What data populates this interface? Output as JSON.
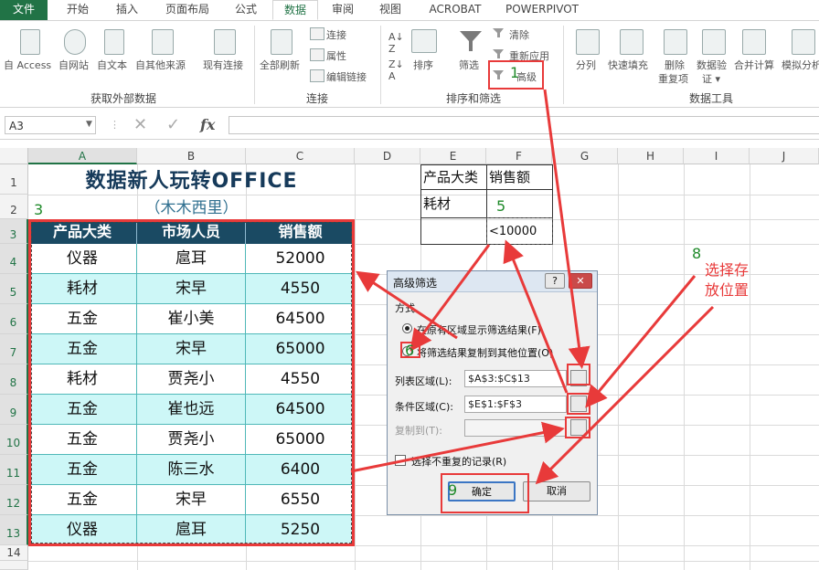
{
  "tabs": [
    "文件",
    "开始",
    "插入",
    "页面布局",
    "公式",
    "数据",
    "审阅",
    "视图",
    "ACROBAT",
    "POWERPIVOT"
  ],
  "ribbon": {
    "get_external": [
      "自 Access",
      "自网站",
      "自文本",
      "自其他来源",
      "现有连接"
    ],
    "get_external_group": "获取外部数据",
    "refresh_all": "全部刷新",
    "connections": "连接",
    "properties": "属性",
    "edit_links": "编辑链接",
    "connections_group": "连接",
    "sort": "排序",
    "filter": "筛选",
    "clear": "清除",
    "reapply": "重新应用",
    "advanced": "高级",
    "sort_filter_group": "排序和筛选",
    "text_to_columns": "分列",
    "flash_fill": "快速填充",
    "remove_dup_1": "删除",
    "remove_dup_2": "重复项",
    "validation_1": "数据验",
    "validation_2": "证 ▾",
    "consolidate": "合并计算",
    "what_if": "模拟分析",
    "data_tools_group": "数据工具"
  },
  "formula_bar": {
    "name_box": "A3",
    "cancel": "✕",
    "enter": "✓",
    "fx": "fx"
  },
  "columns": [
    "A",
    "B",
    "C",
    "D",
    "E",
    "F",
    "G",
    "H",
    "I",
    "J"
  ],
  "rows": [
    "1",
    "2",
    "3",
    "4",
    "5",
    "6",
    "7",
    "8",
    "9",
    "10",
    "11",
    "12",
    "13",
    "14"
  ],
  "sheet": {
    "title": "数据新人玩转OFFICE",
    "subtitle": "（木木西里）",
    "table_headers": [
      "产品大类",
      "市场人员",
      "销售额"
    ],
    "table_rows": [
      [
        "仪器",
        "扈耳",
        "52000"
      ],
      [
        "耗材",
        "宋早",
        "4550"
      ],
      [
        "五金",
        "崔小美",
        "64500"
      ],
      [
        "五金",
        "宋早",
        "65000"
      ],
      [
        "耗材",
        "贾尧小",
        "4550"
      ],
      [
        "五金",
        "崔也远",
        "64500"
      ],
      [
        "五金",
        "贾尧小",
        "65000"
      ],
      [
        "五金",
        "陈三水",
        "6400"
      ],
      [
        "五金",
        "宋早",
        "6550"
      ],
      [
        "仪器",
        "扈耳",
        "5250"
      ]
    ],
    "criteria_headers": [
      "产品大类",
      "销售额"
    ],
    "criteria_row1": [
      "耗材",
      ""
    ],
    "criteria_row2": [
      "",
      "<10000"
    ]
  },
  "dialog": {
    "title": "高级筛选",
    "help": "?",
    "close": "✕",
    "method_label": "方式",
    "option1": "在原有区域显示筛选结果(F)",
    "option2": "将筛选结果复制到其他位置(O)",
    "list_range_label": "列表区域(L):",
    "list_range_value": "$A$3:$C$13",
    "criteria_range_label": "条件区域(C):",
    "criteria_range_value": "$E$1:$F$3",
    "copy_to_label": "复制到(T):",
    "copy_to_value": "",
    "unique_label": "选择不重复的记录(R)",
    "ok": "确定",
    "cancel": "取消"
  },
  "annotations": {
    "n1": "1",
    "n3": "3",
    "n5": "5",
    "n6": "6",
    "n8": "8",
    "n9": "9",
    "note8_line1": "选择存",
    "note8_line2": "放位置"
  },
  "colors": {
    "excel_green": "#217346",
    "header_fill": "#1a4a63",
    "band_fill": "#cdf7f7",
    "annotation_red": "#e83a3a",
    "annotation_green": "#1f8a2a"
  }
}
